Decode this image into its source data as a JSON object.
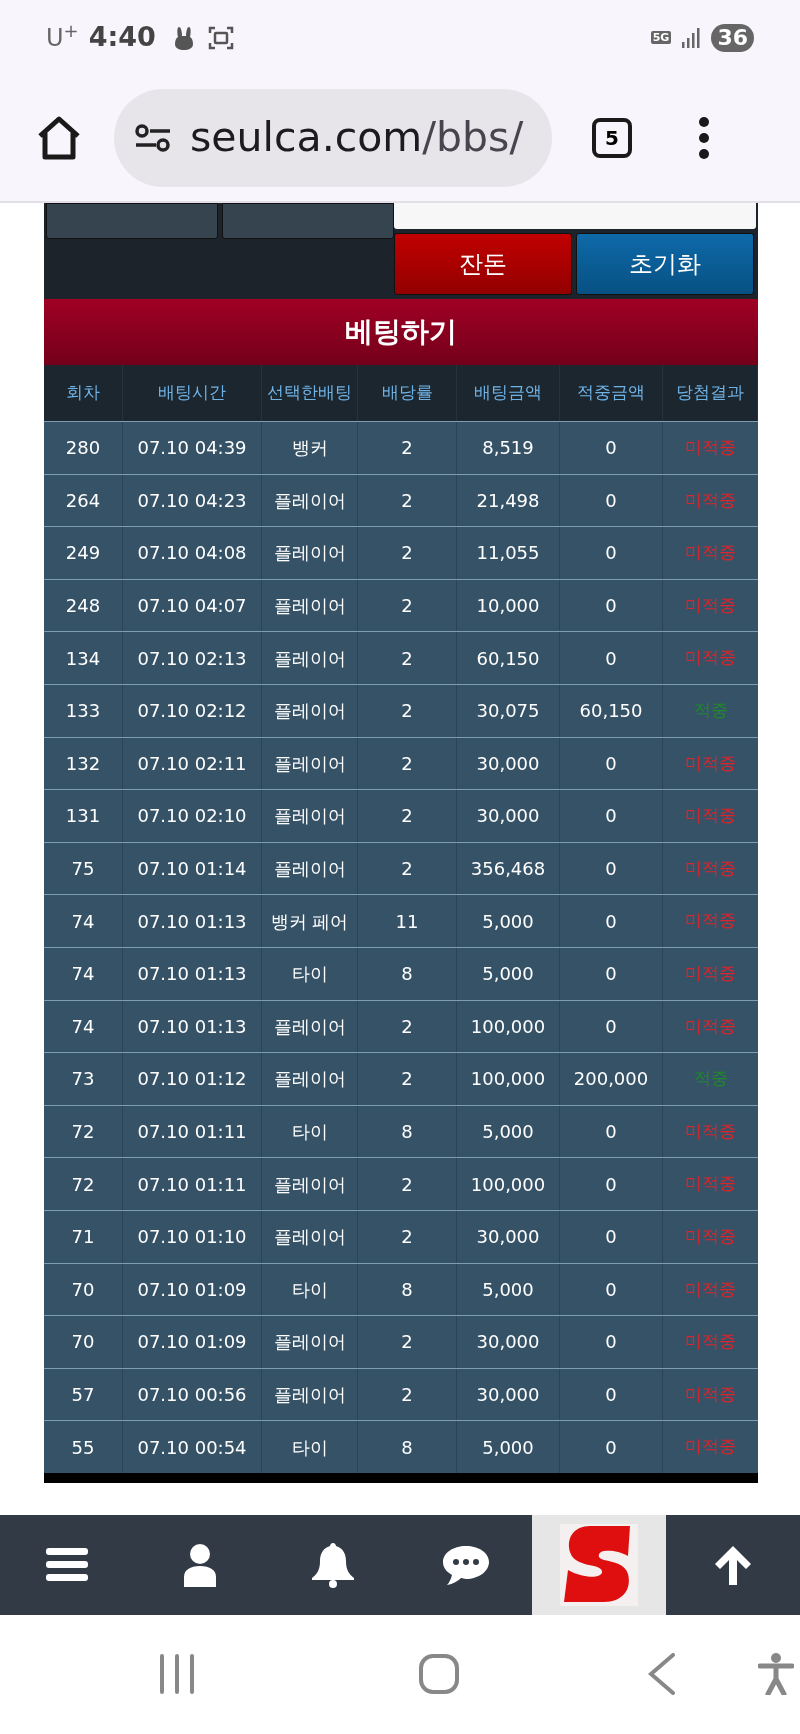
{
  "status_bar": {
    "carrier": "U",
    "carrier_sup": "+",
    "time": "4:40",
    "network": "5G",
    "battery": "36"
  },
  "browser": {
    "url_host": "seulca.com",
    "url_path": "/bbs/",
    "tab_count": "5"
  },
  "controls": {
    "balance_button": "잔돈",
    "reset_button": "초기화"
  },
  "section_title": "베팅하기",
  "table": {
    "columns": [
      "회차",
      "배팅시간",
      "선택한배팅",
      "배당률",
      "배팅금액",
      "적중금액",
      "당첨결과"
    ],
    "rows": [
      {
        "round": "280",
        "time": "07.10 04:39",
        "pick": "뱅커",
        "odds": "2",
        "stake": "8,519",
        "payout": "0",
        "result": "미적중",
        "hit": false
      },
      {
        "round": "264",
        "time": "07.10 04:23",
        "pick": "플레이어",
        "odds": "2",
        "stake": "21,498",
        "payout": "0",
        "result": "미적중",
        "hit": false
      },
      {
        "round": "249",
        "time": "07.10 04:08",
        "pick": "플레이어",
        "odds": "2",
        "stake": "11,055",
        "payout": "0",
        "result": "미적중",
        "hit": false
      },
      {
        "round": "248",
        "time": "07.10 04:07",
        "pick": "플레이어",
        "odds": "2",
        "stake": "10,000",
        "payout": "0",
        "result": "미적중",
        "hit": false
      },
      {
        "round": "134",
        "time": "07.10 02:13",
        "pick": "플레이어",
        "odds": "2",
        "stake": "60,150",
        "payout": "0",
        "result": "미적중",
        "hit": false
      },
      {
        "round": "133",
        "time": "07.10 02:12",
        "pick": "플레이어",
        "odds": "2",
        "stake": "30,075",
        "payout": "60,150",
        "result": "적중",
        "hit": true
      },
      {
        "round": "132",
        "time": "07.10 02:11",
        "pick": "플레이어",
        "odds": "2",
        "stake": "30,000",
        "payout": "0",
        "result": "미적중",
        "hit": false
      },
      {
        "round": "131",
        "time": "07.10 02:10",
        "pick": "플레이어",
        "odds": "2",
        "stake": "30,000",
        "payout": "0",
        "result": "미적중",
        "hit": false
      },
      {
        "round": "75",
        "time": "07.10 01:14",
        "pick": "플레이어",
        "odds": "2",
        "stake": "356,468",
        "payout": "0",
        "result": "미적중",
        "hit": false
      },
      {
        "round": "74",
        "time": "07.10 01:13",
        "pick": "뱅커 페어",
        "odds": "11",
        "stake": "5,000",
        "payout": "0",
        "result": "미적중",
        "hit": false
      },
      {
        "round": "74",
        "time": "07.10 01:13",
        "pick": "타이",
        "odds": "8",
        "stake": "5,000",
        "payout": "0",
        "result": "미적중",
        "hit": false
      },
      {
        "round": "74",
        "time": "07.10 01:13",
        "pick": "플레이어",
        "odds": "2",
        "stake": "100,000",
        "payout": "0",
        "result": "미적중",
        "hit": false
      },
      {
        "round": "73",
        "time": "07.10 01:12",
        "pick": "플레이어",
        "odds": "2",
        "stake": "100,000",
        "payout": "200,000",
        "result": "적중",
        "hit": true
      },
      {
        "round": "72",
        "time": "07.10 01:11",
        "pick": "타이",
        "odds": "8",
        "stake": "5,000",
        "payout": "0",
        "result": "미적중",
        "hit": false
      },
      {
        "round": "72",
        "time": "07.10 01:11",
        "pick": "플레이어",
        "odds": "2",
        "stake": "100,000",
        "payout": "0",
        "result": "미적중",
        "hit": false
      },
      {
        "round": "71",
        "time": "07.10 01:10",
        "pick": "플레이어",
        "odds": "2",
        "stake": "30,000",
        "payout": "0",
        "result": "미적중",
        "hit": false
      },
      {
        "round": "70",
        "time": "07.10 01:09",
        "pick": "타이",
        "odds": "8",
        "stake": "5,000",
        "payout": "0",
        "result": "미적중",
        "hit": false
      },
      {
        "round": "70",
        "time": "07.10 01:09",
        "pick": "플레이어",
        "odds": "2",
        "stake": "30,000",
        "payout": "0",
        "result": "미적중",
        "hit": false
      },
      {
        "round": "57",
        "time": "07.10 00:56",
        "pick": "플레이어",
        "odds": "2",
        "stake": "30,000",
        "payout": "0",
        "result": "미적중",
        "hit": false
      },
      {
        "round": "55",
        "time": "07.10 00:54",
        "pick": "타이",
        "odds": "8",
        "stake": "5,000",
        "payout": "0",
        "result": "미적중",
        "hit": false
      }
    ]
  }
}
